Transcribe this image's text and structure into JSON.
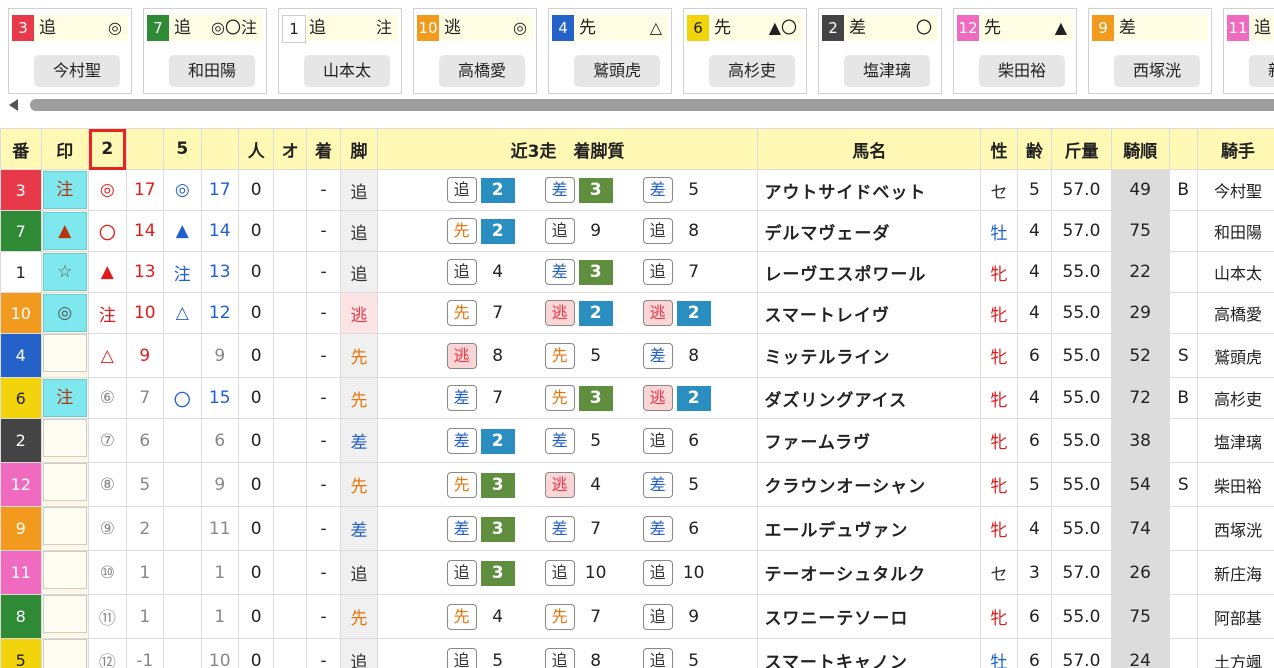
{
  "colors": {
    "waku": {
      "1": "#ffffff",
      "2": "#444444",
      "3": "#e8394a",
      "4": "#2461c8",
      "5": "#f2d40d",
      "6": "#f2d40d",
      "7": "#2f8a36",
      "8": "#2f8a36",
      "9": "#f29a1e",
      "10": "#f29a1e",
      "11": "#f06ac0",
      "12": "#f06ac0"
    },
    "waku_text": {
      "1": "#222222",
      "2": "#ffffff",
      "3": "#ffffff",
      "4": "#ffffff",
      "5": "#222222",
      "6": "#222222",
      "7": "#ffffff",
      "8": "#ffffff",
      "9": "#ffffff",
      "10": "#ffffff",
      "11": "#ffffff",
      "12": "#ffffff"
    },
    "style": {
      "逃": "#e8394a",
      "先": "#e8750b",
      "差": "#2461c8",
      "追": "#333333"
    },
    "highlight_column": "#e8261d"
  },
  "cards": [
    {
      "no": "3",
      "style": "追",
      "mark": "◎",
      "jockey": "今村聖"
    },
    {
      "no": "7",
      "style": "追",
      "mark": "◎〇注",
      "jockey": "和田陽"
    },
    {
      "no": "1",
      "style": "追",
      "mark": "注",
      "jockey": "山本太"
    },
    {
      "no": "10",
      "style": "逃",
      "mark": "◎",
      "jockey": "高橋愛"
    },
    {
      "no": "4",
      "style": "先",
      "mark": "△",
      "jockey": "鷲頭虎"
    },
    {
      "no": "6",
      "style": "先",
      "mark": "▲〇",
      "jockey": "高杉吏"
    },
    {
      "no": "2",
      "style": "差",
      "mark": "〇",
      "jockey": "塩津璃"
    },
    {
      "no": "12",
      "style": "先",
      "mark": "▲",
      "jockey": "柴田裕"
    },
    {
      "no": "9",
      "style": "差",
      "mark": "",
      "jockey": "西塚洸"
    },
    {
      "no": "11",
      "style": "追",
      "mark": "▲",
      "jockey": "新庄海"
    }
  ],
  "headers": {
    "ban": "番",
    "in": "印",
    "c2": "2",
    "c5": "5",
    "ninki": "人",
    "odds": "オ",
    "chaku": "着",
    "kyaku": "脚",
    "recent": "近3走　着脚質",
    "name": "馬名",
    "sex": "性",
    "age": "齢",
    "weight": "斤量",
    "jorder": "騎順",
    "jockey": "騎手"
  },
  "rows": [
    {
      "no": "3",
      "mark": "注",
      "m2": "◎",
      "m2n": "17",
      "m5": "◎",
      "m5n": "17",
      "ninki": "0",
      "odds": "",
      "chaku": "-",
      "style": "追",
      "races": [
        {
          "s": "追",
          "p": "2"
        },
        {
          "s": "差",
          "p": "3"
        },
        {
          "s": "差",
          "p": "5"
        }
      ],
      "name": "アウトサイドベット",
      "sex": "セ",
      "age": "5",
      "weight": "57.0",
      "jorder": "49",
      "flag": "B",
      "jockey": "今村聖"
    },
    {
      "no": "7",
      "mark": "▲",
      "m2": "〇",
      "m2n": "14",
      "m5": "▲",
      "m5n": "14",
      "ninki": "0",
      "odds": "",
      "chaku": "-",
      "style": "追",
      "races": [
        {
          "s": "先",
          "p": "2"
        },
        {
          "s": "追",
          "p": "9"
        },
        {
          "s": "追",
          "p": "8"
        }
      ],
      "name": "デルマヴェーダ",
      "sex": "牡",
      "age": "4",
      "weight": "57.0",
      "jorder": "75",
      "flag": "",
      "jockey": "和田陽"
    },
    {
      "no": "1",
      "mark": "☆",
      "m2": "▲",
      "m2n": "13",
      "m5": "注",
      "m5n": "13",
      "ninki": "0",
      "odds": "",
      "chaku": "-",
      "style": "追",
      "races": [
        {
          "s": "追",
          "p": "4"
        },
        {
          "s": "差",
          "p": "3"
        },
        {
          "s": "追",
          "p": "7"
        }
      ],
      "name": "レーヴエスポワール",
      "sex": "牝",
      "age": "4",
      "weight": "55.0",
      "jorder": "22",
      "flag": "",
      "jockey": "山本太"
    },
    {
      "no": "10",
      "mark": "◎",
      "m2": "注",
      "m2n": "10",
      "m5": "△",
      "m5n": "12",
      "ninki": "0",
      "odds": "",
      "chaku": "-",
      "style": "逃",
      "races": [
        {
          "s": "先",
          "p": "7"
        },
        {
          "s": "逃",
          "p": "2"
        },
        {
          "s": "逃",
          "p": "2"
        }
      ],
      "name": "スマートレイヴ",
      "sex": "牝",
      "age": "4",
      "weight": "55.0",
      "jorder": "29",
      "flag": "",
      "jockey": "高橋愛"
    },
    {
      "no": "4",
      "mark": "",
      "m2": "△",
      "m2n": "9",
      "m5": "",
      "m5n": "9",
      "ninki": "0",
      "odds": "",
      "chaku": "-",
      "style": "先",
      "races": [
        {
          "s": "逃",
          "p": "8"
        },
        {
          "s": "先",
          "p": "5"
        },
        {
          "s": "差",
          "p": "8"
        }
      ],
      "name": "ミッテルライン",
      "sex": "牝",
      "age": "6",
      "weight": "55.0",
      "jorder": "52",
      "flag": "S",
      "jockey": "鷲頭虎"
    },
    {
      "no": "6",
      "mark": "注",
      "m2": "⑥",
      "m2n": "7",
      "m5": "〇",
      "m5n": "15",
      "ninki": "0",
      "odds": "",
      "chaku": "-",
      "style": "先",
      "races": [
        {
          "s": "差",
          "p": "7"
        },
        {
          "s": "先",
          "p": "3"
        },
        {
          "s": "逃",
          "p": "2"
        }
      ],
      "name": "ダズリングアイス",
      "sex": "牝",
      "age": "4",
      "weight": "55.0",
      "jorder": "72",
      "flag": "B",
      "jockey": "高杉吏"
    },
    {
      "no": "2",
      "mark": "",
      "m2": "⑦",
      "m2n": "6",
      "m5": "",
      "m5n": "6",
      "ninki": "0",
      "odds": "",
      "chaku": "-",
      "style": "差",
      "races": [
        {
          "s": "差",
          "p": "2"
        },
        {
          "s": "差",
          "p": "5"
        },
        {
          "s": "追",
          "p": "6"
        }
      ],
      "name": "ファームラヴ",
      "sex": "牝",
      "age": "6",
      "weight": "55.0",
      "jorder": "38",
      "flag": "",
      "jockey": "塩津璃"
    },
    {
      "no": "12",
      "mark": "",
      "m2": "⑧",
      "m2n": "5",
      "m5": "",
      "m5n": "9",
      "ninki": "0",
      "odds": "",
      "chaku": "-",
      "style": "先",
      "races": [
        {
          "s": "先",
          "p": "3"
        },
        {
          "s": "逃",
          "p": "4"
        },
        {
          "s": "差",
          "p": "5"
        }
      ],
      "name": "クラウンオーシャン",
      "sex": "牝",
      "age": "5",
      "weight": "55.0",
      "jorder": "54",
      "flag": "S",
      "jockey": "柴田裕"
    },
    {
      "no": "9",
      "mark": "",
      "m2": "⑨",
      "m2n": "2",
      "m5": "",
      "m5n": "11",
      "ninki": "0",
      "odds": "",
      "chaku": "-",
      "style": "差",
      "races": [
        {
          "s": "差",
          "p": "3"
        },
        {
          "s": "差",
          "p": "7"
        },
        {
          "s": "差",
          "p": "6"
        }
      ],
      "name": "エールデュヴァン",
      "sex": "牝",
      "age": "4",
      "weight": "55.0",
      "jorder": "74",
      "flag": "",
      "jockey": "西塚洸"
    },
    {
      "no": "11",
      "mark": "",
      "m2": "⑩",
      "m2n": "1",
      "m5": "",
      "m5n": "1",
      "ninki": "0",
      "odds": "",
      "chaku": "-",
      "style": "追",
      "races": [
        {
          "s": "追",
          "p": "3"
        },
        {
          "s": "追",
          "p": "10"
        },
        {
          "s": "追",
          "p": "10"
        }
      ],
      "name": "テーオーシュタルク",
      "sex": "セ",
      "age": "3",
      "weight": "57.0",
      "jorder": "26",
      "flag": "",
      "jockey": "新庄海"
    },
    {
      "no": "8",
      "mark": "",
      "m2": "⑪",
      "m2n": "1",
      "m5": "",
      "m5n": "1",
      "ninki": "0",
      "odds": "",
      "chaku": "-",
      "style": "先",
      "races": [
        {
          "s": "先",
          "p": "4"
        },
        {
          "s": "先",
          "p": "7"
        },
        {
          "s": "追",
          "p": "9"
        }
      ],
      "name": "スワニーテソーロ",
      "sex": "牝",
      "age": "6",
      "weight": "55.0",
      "jorder": "75",
      "flag": "",
      "jockey": "阿部基"
    },
    {
      "no": "5",
      "mark": "",
      "m2": "⑫",
      "m2n": "-1",
      "m5": "",
      "m5n": "10",
      "ninki": "0",
      "odds": "",
      "chaku": "-",
      "style": "追",
      "races": [
        {
          "s": "追",
          "p": "5"
        },
        {
          "s": "追",
          "p": "8"
        },
        {
          "s": "追",
          "p": "5"
        }
      ],
      "name": "スマートキャノン",
      "sex": "牡",
      "age": "6",
      "weight": "57.0",
      "jorder": "24",
      "flag": "",
      "jockey": "土方颯"
    }
  ]
}
